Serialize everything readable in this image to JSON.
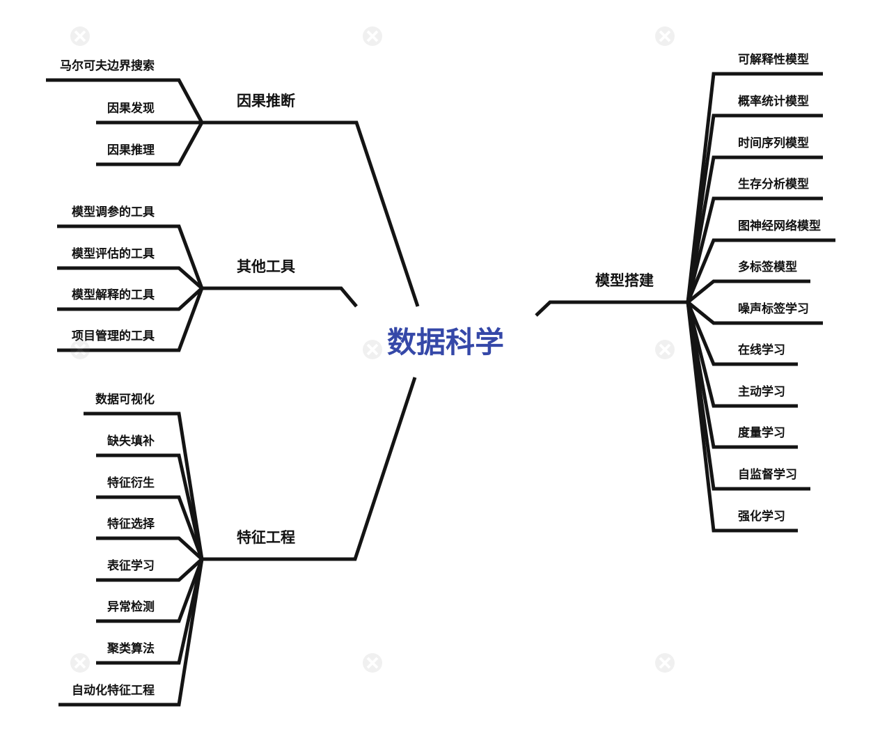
{
  "diagram": {
    "root": {
      "label": "数据科学",
      "color": "#3548a8"
    },
    "branches": [
      {
        "id": "causal",
        "label": "因果推断",
        "side": "left",
        "children": [
          "马尔可夫边界搜索",
          "因果发现",
          "因果推理"
        ]
      },
      {
        "id": "tools",
        "label": "其他工具",
        "side": "left",
        "children": [
          "模型调参的工具",
          "模型评估的工具",
          "模型解释的工具",
          "项目管理的工具"
        ]
      },
      {
        "id": "feature",
        "label": "特征工程",
        "side": "left",
        "children": [
          "数据可视化",
          "缺失填补",
          "特征衍生",
          "特征选择",
          "表征学习",
          "异常检测",
          "聚类算法",
          "自动化特征工程"
        ]
      },
      {
        "id": "modeling",
        "label": "模型搭建",
        "side": "right",
        "children": [
          "可解释性模型",
          "概率统计模型",
          "时间序列模型",
          "生存分析模型",
          "图神经网络模型",
          "多标签模型",
          "噪声标签学习",
          "在线学习",
          "主动学习",
          "度量学习",
          "自监督学习",
          "强化学习"
        ]
      }
    ],
    "line_color": "#141414",
    "watermark_icon": "xmind-logo-icon"
  }
}
